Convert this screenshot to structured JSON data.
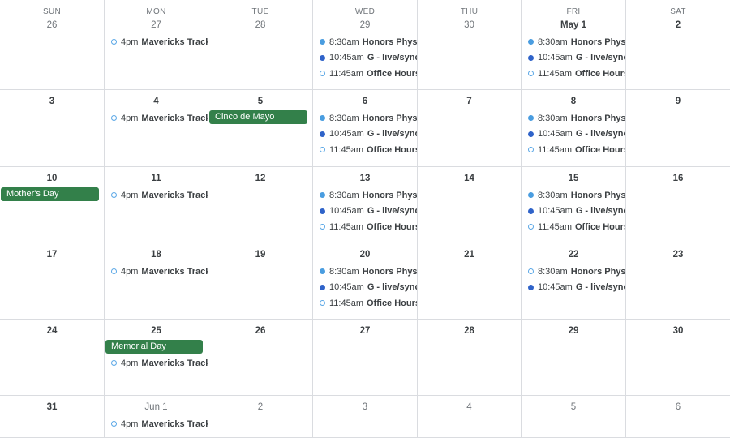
{
  "weekdays": [
    "SUN",
    "MON",
    "TUE",
    "WED",
    "THU",
    "FRI",
    "SAT"
  ],
  "colors": {
    "holiday": "#33804a",
    "event_light_blue": "#4a9de0",
    "event_dark_blue": "#2f63c9",
    "event_outline": "#5aa7e6",
    "grid_line": "#dadce0"
  },
  "weeks": [
    [
      {
        "label": "26",
        "style": "other",
        "events": []
      },
      {
        "label": "27",
        "style": "other",
        "events": [
          {
            "type": "timed",
            "dot": "outline",
            "time": "4pm",
            "title": "Mavericks Track &"
          }
        ]
      },
      {
        "label": "28",
        "style": "other",
        "events": []
      },
      {
        "label": "29",
        "style": "other",
        "events": [
          {
            "type": "timed",
            "dot": "filled-light",
            "time": "8:30am",
            "title": "Honors Physics"
          },
          {
            "type": "timed",
            "dot": "filled-dark",
            "time": "10:45am",
            "title": "G - live/synchr"
          },
          {
            "type": "timed",
            "dot": "outline",
            "time": "11:45am",
            "title": "Office Hours ("
          }
        ]
      },
      {
        "label": "30",
        "style": "other",
        "events": []
      },
      {
        "label": "May 1",
        "style": "bold",
        "events": [
          {
            "type": "timed",
            "dot": "filled-light",
            "time": "8:30am",
            "title": "Honors Physics"
          },
          {
            "type": "timed",
            "dot": "filled-dark",
            "time": "10:45am",
            "title": "G - live/synchr"
          },
          {
            "type": "timed",
            "dot": "outline",
            "time": "11:45am",
            "title": "Office Hours ("
          }
        ]
      },
      {
        "label": "2",
        "style": "bold",
        "events": []
      }
    ],
    [
      {
        "label": "3",
        "style": "normal",
        "events": []
      },
      {
        "label": "4",
        "style": "normal",
        "events": [
          {
            "type": "timed",
            "dot": "outline",
            "time": "4pm",
            "title": "Mavericks Track &"
          }
        ]
      },
      {
        "label": "5",
        "style": "normal",
        "events": [
          {
            "type": "allday",
            "title": "Cinco de Mayo"
          }
        ]
      },
      {
        "label": "6",
        "style": "normal",
        "events": [
          {
            "type": "timed",
            "dot": "filled-light",
            "time": "8:30am",
            "title": "Honors Physics"
          },
          {
            "type": "timed",
            "dot": "filled-dark",
            "time": "10:45am",
            "title": "G - live/synchr"
          },
          {
            "type": "timed",
            "dot": "outline",
            "time": "11:45am",
            "title": "Office Hours ("
          }
        ]
      },
      {
        "label": "7",
        "style": "normal",
        "events": []
      },
      {
        "label": "8",
        "style": "normal",
        "events": [
          {
            "type": "timed",
            "dot": "filled-light",
            "time": "8:30am",
            "title": "Honors Physics"
          },
          {
            "type": "timed",
            "dot": "filled-dark",
            "time": "10:45am",
            "title": "G - live/synchr"
          },
          {
            "type": "timed",
            "dot": "outline",
            "time": "11:45am",
            "title": "Office Hours ("
          }
        ]
      },
      {
        "label": "9",
        "style": "normal",
        "events": []
      }
    ],
    [
      {
        "label": "10",
        "style": "normal",
        "events": [
          {
            "type": "allday",
            "title": "Mother's Day"
          }
        ]
      },
      {
        "label": "11",
        "style": "normal",
        "events": [
          {
            "type": "timed",
            "dot": "outline",
            "time": "4pm",
            "title": "Mavericks Track &"
          }
        ]
      },
      {
        "label": "12",
        "style": "normal",
        "events": []
      },
      {
        "label": "13",
        "style": "normal",
        "events": [
          {
            "type": "timed",
            "dot": "filled-light",
            "time": "8:30am",
            "title": "Honors Physics"
          },
          {
            "type": "timed",
            "dot": "filled-dark",
            "time": "10:45am",
            "title": "G - live/synchr"
          },
          {
            "type": "timed",
            "dot": "outline",
            "time": "11:45am",
            "title": "Office Hours ("
          }
        ]
      },
      {
        "label": "14",
        "style": "normal",
        "events": []
      },
      {
        "label": "15",
        "style": "normal",
        "events": [
          {
            "type": "timed",
            "dot": "filled-light",
            "time": "8:30am",
            "title": "Honors Physics"
          },
          {
            "type": "timed",
            "dot": "filled-dark",
            "time": "10:45am",
            "title": "G - live/synchr"
          },
          {
            "type": "timed",
            "dot": "outline",
            "time": "11:45am",
            "title": "Office Hours ("
          }
        ]
      },
      {
        "label": "16",
        "style": "normal",
        "events": []
      }
    ],
    [
      {
        "label": "17",
        "style": "normal",
        "events": []
      },
      {
        "label": "18",
        "style": "normal",
        "events": [
          {
            "type": "timed",
            "dot": "outline",
            "time": "4pm",
            "title": "Mavericks Track &"
          }
        ]
      },
      {
        "label": "19",
        "style": "normal",
        "events": []
      },
      {
        "label": "20",
        "style": "normal",
        "events": [
          {
            "type": "timed",
            "dot": "filled-light",
            "time": "8:30am",
            "title": "Honors Physics"
          },
          {
            "type": "timed",
            "dot": "filled-dark",
            "time": "10:45am",
            "title": "G - live/synchr"
          },
          {
            "type": "timed",
            "dot": "outline",
            "time": "11:45am",
            "title": "Office Hours ("
          }
        ]
      },
      {
        "label": "21",
        "style": "normal",
        "events": []
      },
      {
        "label": "22",
        "style": "normal",
        "events": [
          {
            "type": "timed",
            "dot": "outline",
            "time": "8:30am",
            "title": "Honors Physics"
          },
          {
            "type": "timed",
            "dot": "filled-dark",
            "time": "10:45am",
            "title": "G - live/synchr"
          }
        ]
      },
      {
        "label": "23",
        "style": "normal",
        "events": []
      }
    ],
    [
      {
        "label": "24",
        "style": "normal",
        "events": []
      },
      {
        "label": "25",
        "style": "normal",
        "events": [
          {
            "type": "allday",
            "title": "Memorial Day"
          },
          {
            "type": "timed",
            "dot": "outline",
            "time": "4pm",
            "title": "Mavericks Track &"
          }
        ]
      },
      {
        "label": "26",
        "style": "normal",
        "events": []
      },
      {
        "label": "27",
        "style": "normal",
        "events": []
      },
      {
        "label": "28",
        "style": "normal",
        "events": []
      },
      {
        "label": "29",
        "style": "normal",
        "events": []
      },
      {
        "label": "30",
        "style": "normal",
        "events": []
      }
    ],
    [
      {
        "label": "31",
        "style": "normal",
        "events": []
      },
      {
        "label": "Jun 1",
        "style": "other",
        "events": [
          {
            "type": "timed",
            "dot": "outline",
            "time": "4pm",
            "title": "Mavericks Track &"
          }
        ]
      },
      {
        "label": "2",
        "style": "other",
        "events": []
      },
      {
        "label": "3",
        "style": "other",
        "events": []
      },
      {
        "label": "4",
        "style": "other",
        "events": []
      },
      {
        "label": "5",
        "style": "other",
        "events": []
      },
      {
        "label": "6",
        "style": "other",
        "events": []
      }
    ]
  ]
}
